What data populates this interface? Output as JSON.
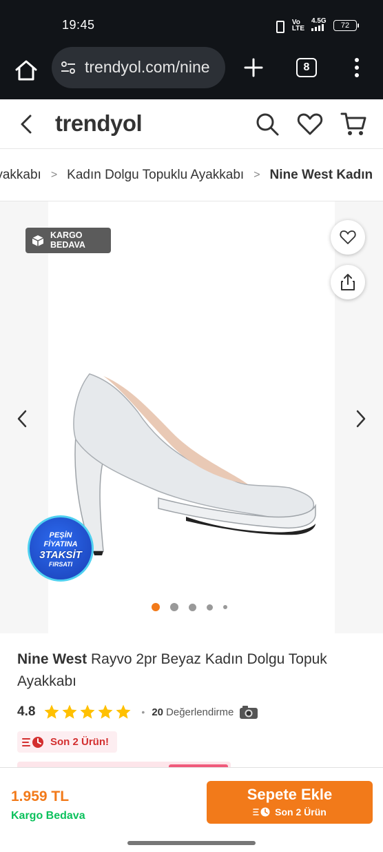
{
  "status_bar": {
    "time": "19:45",
    "network_label_top": "Vo",
    "network_label_bottom": "LTE",
    "signal_label": "4.5G",
    "battery": "72"
  },
  "browser": {
    "url": "trendyol.com/nine",
    "tab_count": "8"
  },
  "app_header": {
    "logo": "trendyol",
    "icons": [
      "search-icon",
      "heart-icon",
      "cart-icon"
    ]
  },
  "breadcrumb": {
    "items": [
      "Ayakkabı",
      "Kadın Dolgu Topuklu Ayakkabı",
      "Nine West Kadın"
    ]
  },
  "gallery": {
    "badge_line1": "KARGO",
    "badge_line2": "BEDAVA",
    "promo_line1": "PEŞİN",
    "promo_line2": "FİYATINA",
    "promo_line3": "3TAKSİT",
    "promo_line4": "FIRSATI",
    "dot_count": 5,
    "active_dot": 0,
    "active_color": "#f27a1a"
  },
  "product": {
    "brand": "Nine West",
    "name": "Rayvo 2pr Beyaz Kadın Dolgu Topuk Ayakkabı",
    "rating": "4.8",
    "stars": 5,
    "review_count": "20",
    "review_label": "Değerlendirme",
    "stock_text": "Son 2 Ürün!"
  },
  "bottom_bar": {
    "price": "1.959 TL",
    "shipping": "Kargo Bedava",
    "add_button": "Sepete Ekle",
    "add_button_sub": "Son 2 Ürün"
  },
  "colors": {
    "brand_orange": "#f27a1a",
    "green": "#0bc15c",
    "stock_red": "#d32f2f",
    "star": "#ffc000"
  }
}
